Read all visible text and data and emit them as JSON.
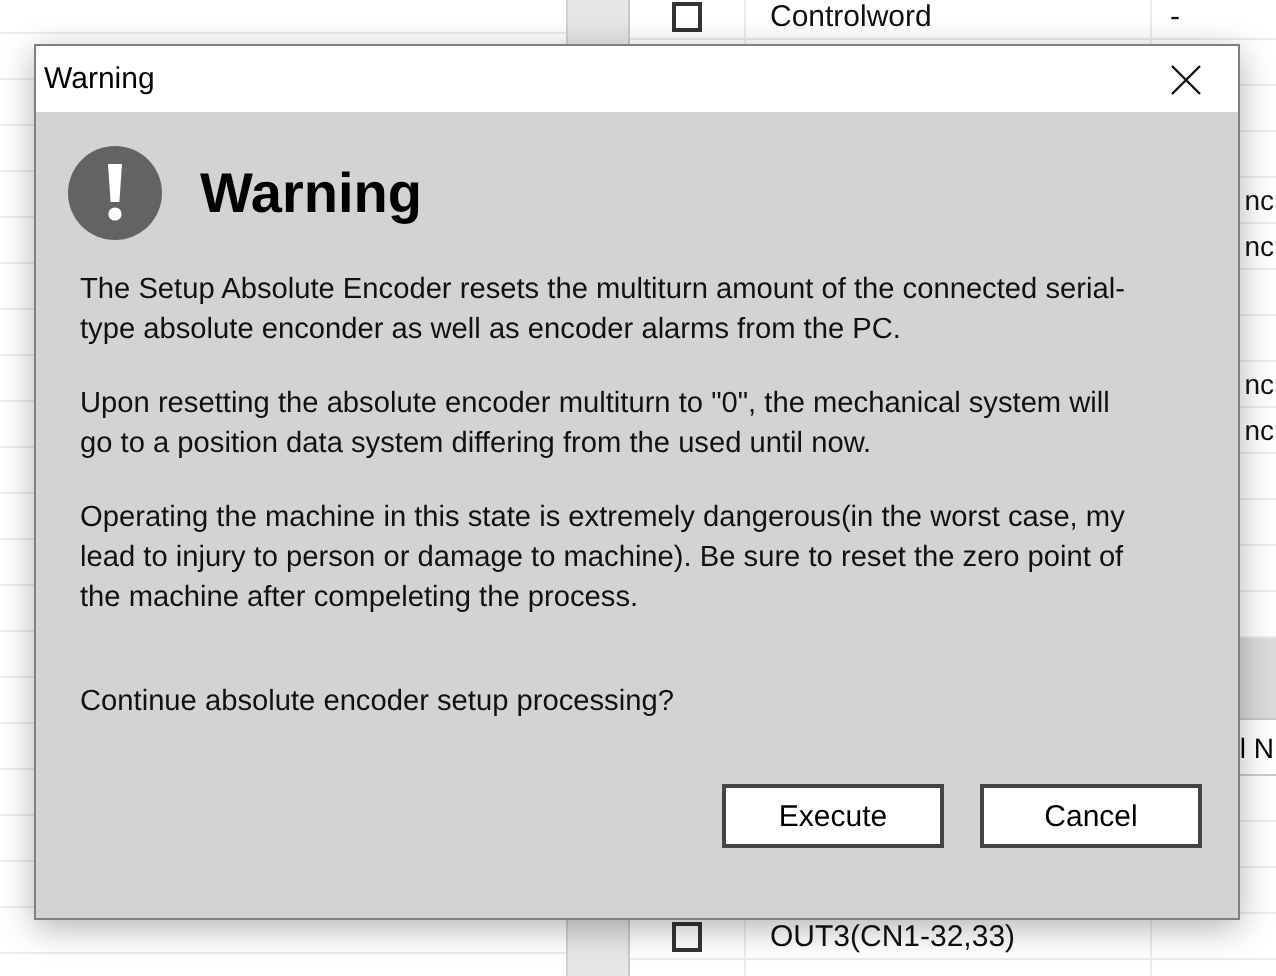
{
  "background": {
    "upper_rows": [
      {
        "checked": false,
        "name": "Controlword",
        "value": "-"
      },
      {},
      {},
      {},
      {
        "edge": "nc"
      },
      {
        "edge": "nc"
      },
      {},
      {},
      {
        "edge": "nc"
      },
      {
        "edge": "nc"
      },
      {},
      {},
      {},
      {}
    ],
    "header": {
      "edge": "l N"
    },
    "lower_rows": [
      {},
      {},
      {},
      {
        "checked": false,
        "name": "OUT3(CN1-32,33)"
      },
      {}
    ]
  },
  "dialog": {
    "title": "Warning",
    "heading": "Warning",
    "paragraphs": [
      "The Setup Absolute Encoder resets the multiturn amount of the connected serial-type absolute enconder as well as encoder alarms from the PC.",
      "Upon resetting the absolute encoder multiturn to \"0\", the mechanical system will go to a position data system differing from the used until now.",
      "Operating the machine in this state is extremely dangerous(in the worst case, my lead to injury to person or damage to machine). Be sure to reset the zero point of the machine after compeleting the process."
    ],
    "question": "Continue absolute encoder setup processing?",
    "buttons": [
      "Execute",
      "Cancel"
    ]
  }
}
